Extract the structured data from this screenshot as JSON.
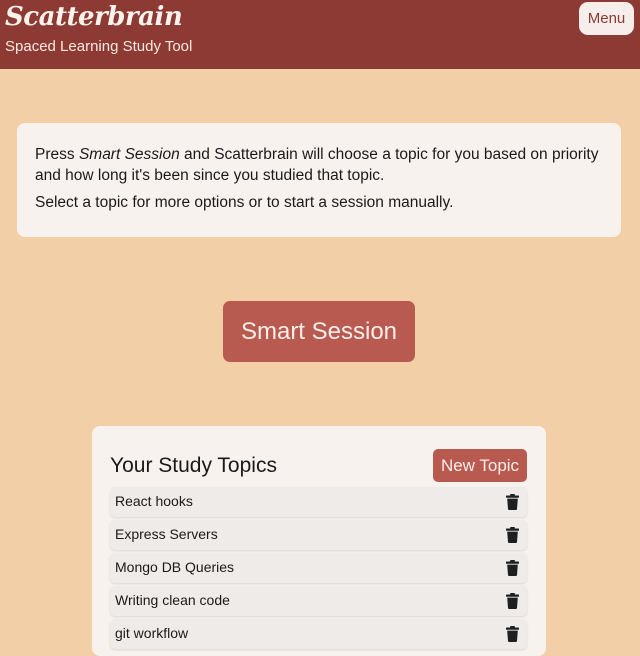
{
  "header": {
    "title": "Scatterbrain",
    "subtitle": "Spaced Learning Study Tool",
    "menu_label": "Menu"
  },
  "info": {
    "line1_prefix": "Press ",
    "line1_emphasis": "Smart Session",
    "line1_suffix": " and Scatterbrain will choose a topic for you based on priority and how long it's been since you studied that topic.",
    "line2": "Select a topic for more options or to start a session manually."
  },
  "smart_session_label": "Smart Session",
  "topics": {
    "title": "Your Study Topics",
    "new_topic_label": "New Topic",
    "items": [
      {
        "label": "React hooks",
        "icon": "trash-icon"
      },
      {
        "label": "Express Servers",
        "icon": "trash-icon"
      },
      {
        "label": "Mongo DB Queries",
        "icon": "trash-icon"
      },
      {
        "label": "Writing clean code",
        "icon": "trash-icon"
      },
      {
        "label": "git workflow",
        "icon": "trash-icon"
      }
    ]
  },
  "colors": {
    "header_bg": "#8c3a33",
    "page_bg": "#f2cfa6",
    "accent_button": "#b85a50",
    "card_bg": "#f8f2ef"
  }
}
